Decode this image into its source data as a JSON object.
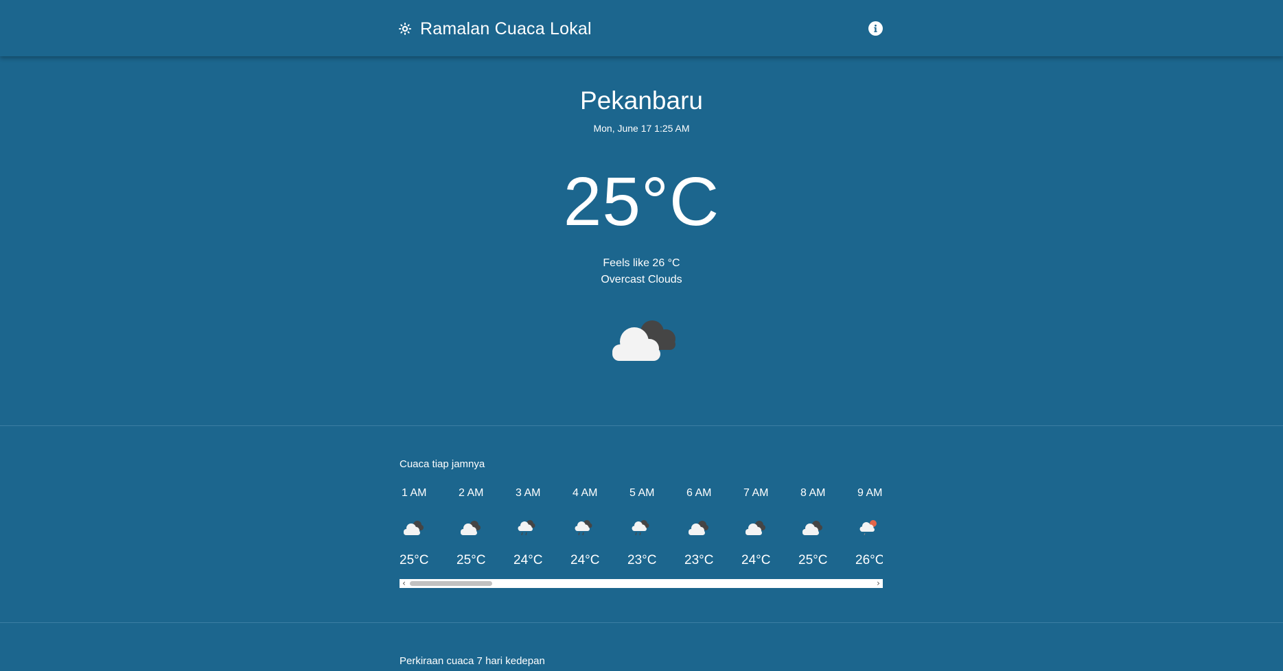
{
  "app": {
    "title": "Ramalan Cuaca Lokal",
    "brand_icon": "sun-icon",
    "info_icon": "info-icon"
  },
  "current": {
    "city": "Pekanbaru",
    "datetime": "Mon, June 17 1:25 AM",
    "temperature": "25°C",
    "feels_like": "Feels like 26 °C",
    "description": "Overcast Clouds",
    "icon": "overcast-clouds-icon"
  },
  "hourly": {
    "title": "Cuaca tiap jamnya",
    "items": [
      {
        "time": "1 AM",
        "temp": "25°C",
        "icon": "cloud-night-icon"
      },
      {
        "time": "2 AM",
        "temp": "25°C",
        "icon": "cloud-night-icon"
      },
      {
        "time": "3 AM",
        "temp": "24°C",
        "icon": "cloud-rain-icon"
      },
      {
        "time": "4 AM",
        "temp": "24°C",
        "icon": "cloud-rain-icon"
      },
      {
        "time": "5 AM",
        "temp": "23°C",
        "icon": "cloud-rain-icon"
      },
      {
        "time": "6 AM",
        "temp": "23°C",
        "icon": "cloud-night-icon"
      },
      {
        "time": "7 AM",
        "temp": "24°C",
        "icon": "cloud-night-icon"
      },
      {
        "time": "8 AM",
        "temp": "25°C",
        "icon": "cloud-night-icon"
      },
      {
        "time": "9 AM",
        "temp": "26°C",
        "icon": "cloud-sun-icon"
      }
    ]
  },
  "weekly": {
    "title": "Perkiraan cuaca 7 hari kedepan"
  },
  "colors": {
    "background": "#1c668e",
    "divider": "#3c7fa3",
    "text": "#ffffff",
    "cloud_light": "#f2f2f2",
    "cloud_dark": "#454545",
    "sun": "#e2664a"
  }
}
